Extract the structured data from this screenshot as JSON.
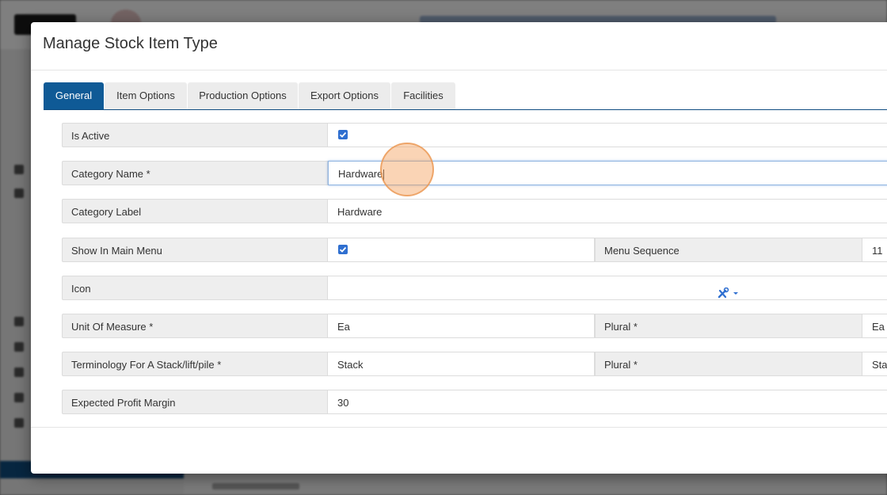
{
  "modal": {
    "title": "Manage Stock Item Type"
  },
  "tabs": [
    {
      "label": "General",
      "active": true
    },
    {
      "label": "Item Options",
      "active": false
    },
    {
      "label": "Production Options",
      "active": false
    },
    {
      "label": "Export Options",
      "active": false
    },
    {
      "label": "Facilities",
      "active": false
    }
  ],
  "form": {
    "is_active": {
      "label": "Is Active",
      "checked": true
    },
    "category_name": {
      "label": "Category Name *",
      "value": "Hardware"
    },
    "category_label": {
      "label": "Category Label",
      "value": "Hardware"
    },
    "show_in_main_menu": {
      "label": "Show In Main Menu",
      "checked": true
    },
    "menu_sequence": {
      "label": "Menu Sequence",
      "value": "11"
    },
    "icon": {
      "label": "Icon",
      "value_icon": "tools-icon"
    },
    "unit_of_measure": {
      "label": "Unit Of Measure *",
      "value": "Ea"
    },
    "unit_plural": {
      "label": "Plural *",
      "value": "Ea"
    },
    "stack_terminology": {
      "label": "Terminology For A Stack/lift/pile *",
      "value": "Stack"
    },
    "stack_plural": {
      "label": "Plural *",
      "value": "Sta"
    },
    "expected_profit_margin": {
      "label": "Expected Profit Margin",
      "value": "30"
    }
  },
  "colors": {
    "primary": "#0f5a96",
    "checkbox": "#2f6fd0",
    "click_indicator": "#f5a05a"
  }
}
